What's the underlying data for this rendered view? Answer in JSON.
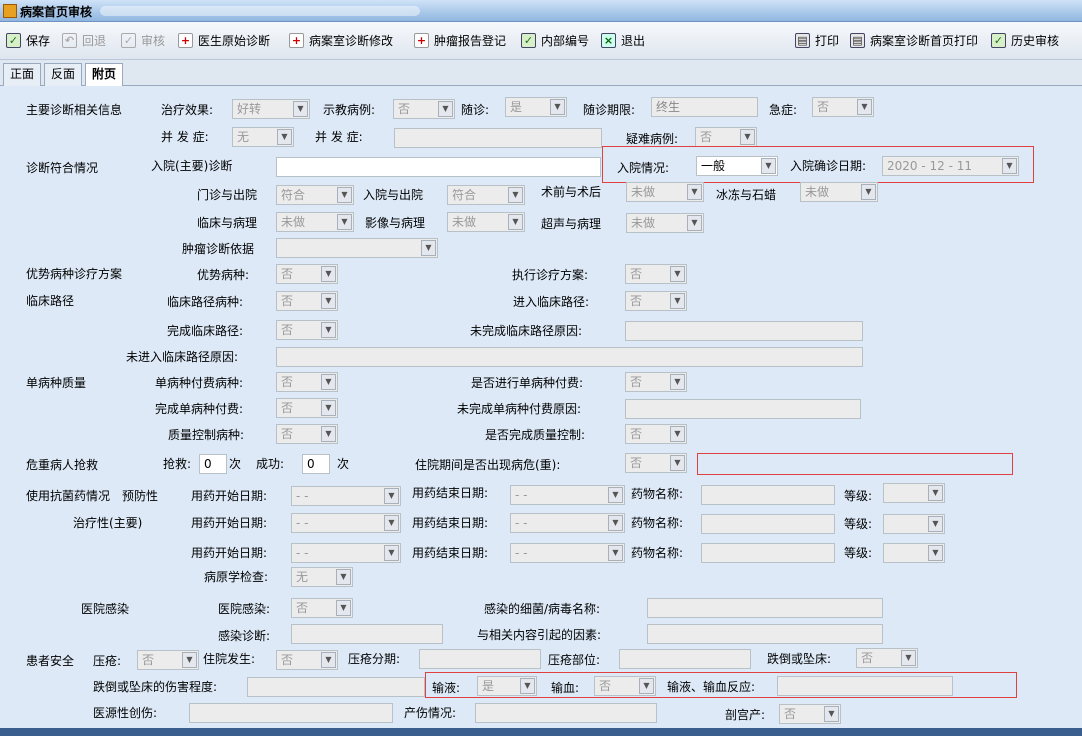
{
  "window": {
    "title": "病案首页审核"
  },
  "toolbar": {
    "save": "保存",
    "rollback": "回退",
    "audit": "审核",
    "doctor_diag": "医生原始诊断",
    "pathology_edit": "病案室诊断修改",
    "tumor_report": "肿瘤报告登记",
    "internal_no": "内部编号",
    "exit": "退出",
    "print": "打印",
    "front_print": "病案室诊断首页打印",
    "history_audit": "历史审核"
  },
  "tabs": [
    "正面",
    "反面",
    "附页"
  ],
  "form": {
    "main_diag_info": "主要诊断相关信息",
    "treat_effect": "治疗效果:",
    "treat_effect_val": "好转",
    "teach_case": "示教病例:",
    "teach_case_val": "否",
    "followup": "随诊:",
    "followup_val": "是",
    "followup_period": "随诊期限:",
    "followup_period_val": "终生",
    "emergency": "急症:",
    "emergency_val": "否",
    "complication1": "并 发 症:",
    "complication1_val": "无",
    "complication2": "并 发 症:",
    "difficult_case": "疑难病例:",
    "difficult_case_val": "否",
    "diag_match": "诊断符合情况",
    "admit_main_diag": "入院(主要)诊断",
    "admit_status": "入院情况:",
    "admit_status_val": "一般",
    "admit_confirm_date": "入院确诊日期:",
    "admit_confirm_date_val": "2020 - 12 - 11",
    "outpatient_discharge": "门诊与出院",
    "outpatient_discharge_val": "符合",
    "admit_discharge": "入院与出院",
    "admit_discharge_val": "符合",
    "pre_post_op": "术前与术后",
    "pre_post_op_val": "未做",
    "frozen_paraffin": "冰冻与石蜡",
    "frozen_paraffin_val": "未做",
    "clinical_path": "临床与病理",
    "clinical_path_val": "未做",
    "imaging_path": "影像与病理",
    "imaging_path_val": "未做",
    "ultrasound_path": "超声与病理",
    "ultrasound_path_val": "未做",
    "tumor_diag_basis": "肿瘤诊断依据",
    "adv_disease_plan": "优势病种诊疗方案",
    "adv_disease": "优势病种:",
    "adv_disease_val": "否",
    "exec_plan": "执行诊疗方案:",
    "exec_plan_val": "否",
    "clinical_pathway": "临床路径",
    "pathway_disease": "临床路径病种:",
    "pathway_disease_val": "否",
    "enter_pathway": "进入临床路径:",
    "enter_pathway_val": "否",
    "complete_pathway": "完成临床路径:",
    "complete_pathway_val": "否",
    "incomplete_reason": "未完成临床路径原因:",
    "not_enter_reason": "未进入临床路径原因:",
    "single_quality": "单病种质量",
    "single_pay_disease": "单病种付费病种:",
    "single_pay_disease_val": "否",
    "do_single_pay": "是否进行单病种付费:",
    "do_single_pay_val": "否",
    "complete_single_pay": "完成单病种付费:",
    "complete_single_pay_val": "否",
    "incomplete_single_pay": "未完成单病种付费原因:",
    "qc_disease": "质量控制病种:",
    "qc_disease_val": "否",
    "complete_qc": "是否完成质量控制:",
    "complete_qc_val": "否",
    "critical_rescue": "危重病人抢救",
    "rescue": "抢救:",
    "rescue_val": "0",
    "times1": "次",
    "success": "成功:",
    "success_val": "0",
    "times2": "次",
    "critical_during": "住院期间是否出现病危(重):",
    "critical_during_val": "否",
    "antibiotic": "使用抗菌药情况",
    "preventive": "预防性",
    "therapeutic": "治疗性(主要)",
    "start_date": "用药开始日期:",
    "end_date": "用药结束日期:",
    "date_val": "-  -",
    "drug_name": "药物名称:",
    "grade": "等级:",
    "pathogen_check": "病原学检查:",
    "pathogen_check_val": "无",
    "hospital_infection": "医院感染",
    "hosp_infect": "医院感染:",
    "hosp_infect_val": "否",
    "bacteria_name": "感染的细菌/病毒名称:",
    "infect_diag": "感染诊断:",
    "related_factor": "与相关内容引起的因素:",
    "patient_safety": "患者安全",
    "pressure_sore": "压疮:",
    "pressure_sore_val": "否",
    "in_hospital": "住院发生:",
    "in_hospital_val": "否",
    "sore_stage": "压疮分期:",
    "sore_site": "压疮部位:",
    "fall": "跌倒或坠床:",
    "fall_val": "否",
    "fall_injury": "跌倒或坠床的伤害程度:",
    "transfusion": "输液:",
    "transfusion_val": "是",
    "blood": "输血:",
    "blood_val": "否",
    "transfusion_reaction": "输液、输血反应:",
    "iatrogenic": "医源性创伤:",
    "birth_injury": "产伤情况:",
    "cesarean": "剖宫产:",
    "cesarean_val": "否"
  }
}
